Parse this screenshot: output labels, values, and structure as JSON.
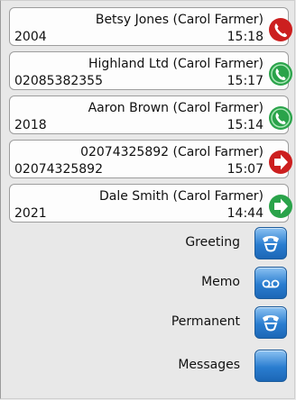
{
  "calls": [
    {
      "caller": "Betsy Jones (Carol Farmer)",
      "number": "2004",
      "time": "15:18",
      "status": "missed-call-icon",
      "color": "#cc1f1f"
    },
    {
      "caller": "Highland Ltd (Carol Farmer)",
      "number": "02085382355",
      "time": "15:17",
      "status": "incoming-call-icon",
      "color": "#2aa34a"
    },
    {
      "caller": "Aaron Brown (Carol Farmer)",
      "number": "2018",
      "time": "15:14",
      "status": "incoming-call-icon",
      "color": "#2aa34a"
    },
    {
      "caller": "02074325892 (Carol Farmer)",
      "number": "02074325892",
      "time": "15:07",
      "status": "outgoing-missed-icon",
      "color": "#cc1f1f"
    },
    {
      "caller": "Dale Smith (Carol Farmer)",
      "number": "2021",
      "time": "14:44",
      "status": "outgoing-call-icon",
      "color": "#2aa34a"
    }
  ],
  "actions": [
    {
      "label": "Greeting",
      "icon": "greeting-icon"
    },
    {
      "label": "Memo",
      "icon": "voicemail-icon"
    },
    {
      "label": "Permanent",
      "icon": "permanent-greeting-icon"
    },
    {
      "label": "Messages",
      "icon": "messages-icon"
    }
  ]
}
